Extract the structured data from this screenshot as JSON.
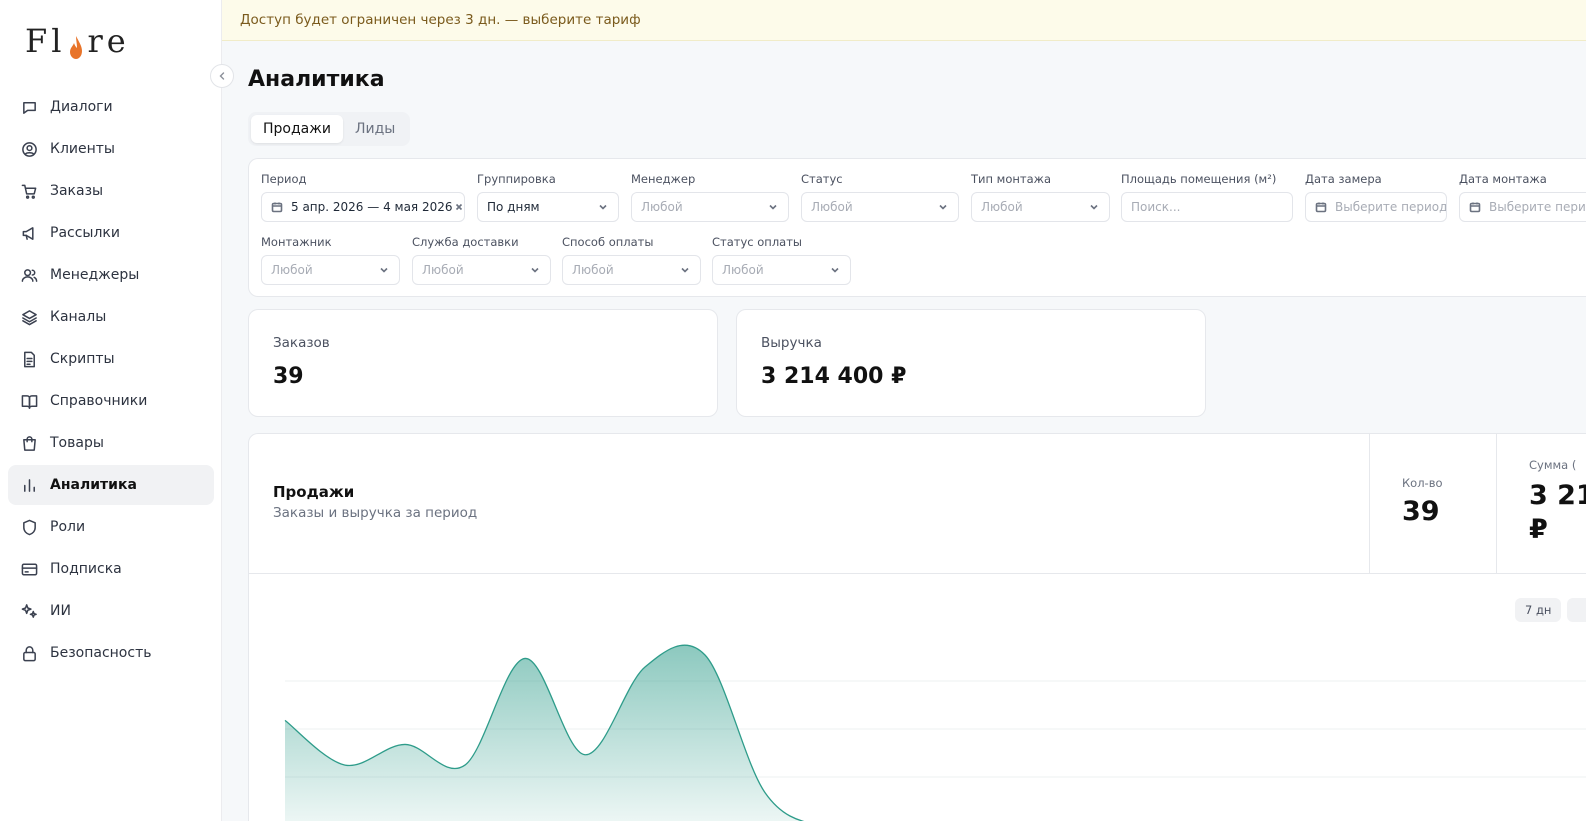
{
  "brand": {
    "logo_left": "Fl",
    "logo_right": "re",
    "accent": "#e8742a"
  },
  "banner": {
    "text": "Доступ будет ограничен через 3 дн. — выберите тариф"
  },
  "sidebar": {
    "items": [
      {
        "label": "Диалоги",
        "icon": "chat-icon"
      },
      {
        "label": "Клиенты",
        "icon": "user-circle-icon"
      },
      {
        "label": "Заказы",
        "icon": "cart-icon"
      },
      {
        "label": "Рассылки",
        "icon": "megaphone-icon"
      },
      {
        "label": "Менеджеры",
        "icon": "users-icon"
      },
      {
        "label": "Каналы",
        "icon": "layers-icon"
      },
      {
        "label": "Скрипты",
        "icon": "file-text-icon"
      },
      {
        "label": "Справочники",
        "icon": "book-icon"
      },
      {
        "label": "Товары",
        "icon": "bag-icon"
      },
      {
        "label": "Аналитика",
        "icon": "bar-chart-icon",
        "active": true
      },
      {
        "label": "Роли",
        "icon": "shield-icon"
      },
      {
        "label": "Подписка",
        "icon": "credit-card-icon"
      },
      {
        "label": "ИИ",
        "icon": "sparkles-icon"
      },
      {
        "label": "Безопасность",
        "icon": "lock-icon"
      }
    ]
  },
  "page": {
    "title": "Аналитика"
  },
  "tabs": [
    {
      "label": "Продажи",
      "active": true
    },
    {
      "label": "Лиды"
    }
  ],
  "filters": {
    "period": {
      "label": "Период",
      "value": "5 апр. 2026 — 4 мая 2026"
    },
    "grouping": {
      "label": "Группировка",
      "value": "По дням"
    },
    "manager": {
      "label": "Менеджер",
      "value": "Любой"
    },
    "status": {
      "label": "Статус",
      "value": "Любой"
    },
    "mount_type": {
      "label": "Тип монтажа",
      "value": "Любой"
    },
    "area": {
      "label": "Площадь помещения (м²)",
      "placeholder": "Поиск..."
    },
    "measure_date": {
      "label": "Дата замера",
      "placeholder": "Выберите период"
    },
    "mount_date": {
      "label": "Дата монтажа",
      "placeholder": "Выберите период"
    },
    "installer": {
      "label": "Монтажник",
      "value": "Любой"
    },
    "delivery": {
      "label": "Служба доставки",
      "value": "Любой"
    },
    "payment_method": {
      "label": "Способ оплаты",
      "value": "Любой"
    },
    "payment_status": {
      "label": "Статус оплаты",
      "value": "Любой"
    }
  },
  "stats": {
    "orders": {
      "label": "Заказов",
      "value": "39"
    },
    "revenue": {
      "label": "Выручка",
      "value": "3 214 400 ₽"
    }
  },
  "sales_chart": {
    "title": "Продажи",
    "subtitle": "Заказы и выручка за период",
    "count_label": "Кол-во",
    "count_value": "39",
    "sum_label": "Сумма (",
    "sum_value_line1": "3 21",
    "sum_value_line2": "₽",
    "range_label": "7 дн",
    "color": "#2e9c8a"
  },
  "chart_data": {
    "type": "area",
    "title": "Продажи",
    "x": [
      0,
      1,
      2,
      3,
      4,
      5,
      6,
      7,
      8,
      9,
      10,
      11,
      12
    ],
    "values": [
      0.62,
      0.36,
      0.48,
      0.36,
      0.98,
      0.42,
      0.93,
      1.0,
      0.2,
      0.0,
      0.0,
      0.0,
      0.0
    ],
    "grid": true
  }
}
